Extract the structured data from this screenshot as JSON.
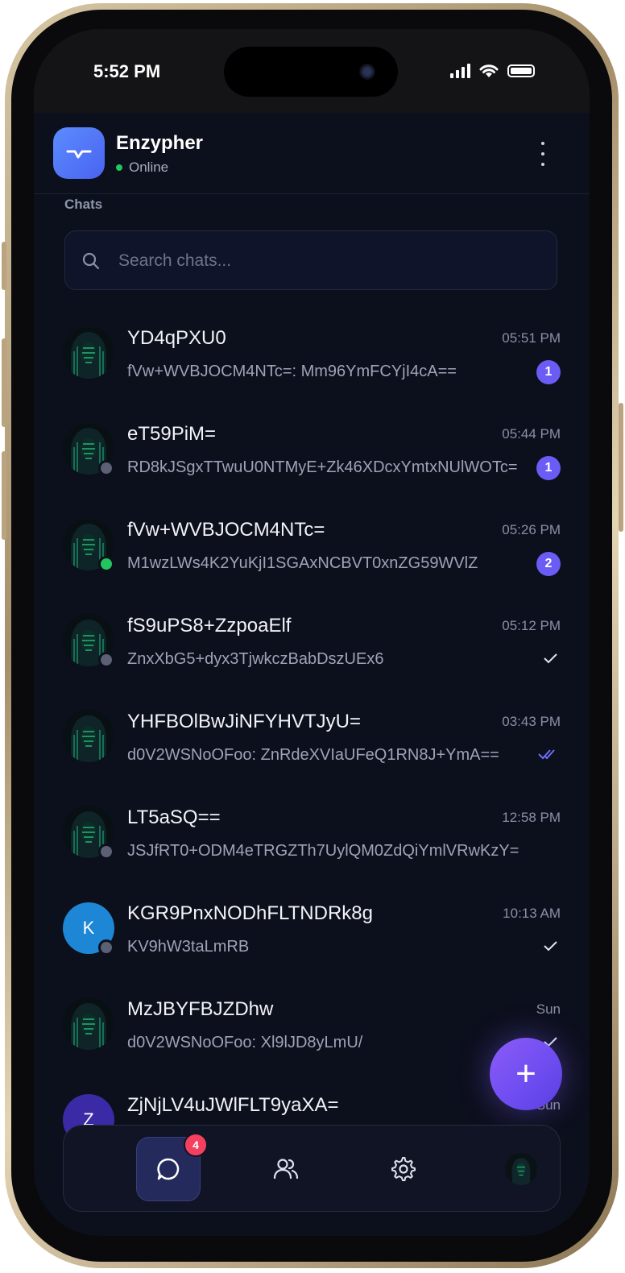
{
  "status_bar": {
    "time": "5:52 PM"
  },
  "header": {
    "app_name": "Enzypher",
    "status": "Online"
  },
  "section_title": "Chats",
  "search": {
    "placeholder": "Search chats..."
  },
  "chats": [
    {
      "name": "YD4qPXU0",
      "time": "05:51 PM",
      "preview": "fVw+WVBJOCM4NTc=: Mm96YmFCYjI4cA==",
      "unread": "1",
      "avatar": "hooded-figure",
      "presence": "none",
      "receipt": "none"
    },
    {
      "name": "eT59PiM=",
      "time": "05:44 PM",
      "preview": "RD8kJSgxTTwuU0NTMyE+Zk46XDcxYmtxNUlWOTc=",
      "unread": "1",
      "avatar": "hooded-figure",
      "presence": "offline",
      "receipt": "none"
    },
    {
      "name": "fVw+WVBJOCM4NTc=",
      "time": "05:26 PM",
      "preview": "M1wzLWs4K2YuKjI1SGAxNCBVT0xnZG59WVlZ",
      "unread": "2",
      "avatar": "hooded-figure",
      "presence": "online",
      "receipt": "none"
    },
    {
      "name": "fS9uPS8+ZzpoaElf",
      "time": "05:12 PM",
      "preview": "ZnxXbG5+dyx3TjwkczBabDszUEx6",
      "unread": "",
      "avatar": "hooded-figure",
      "presence": "offline",
      "receipt": "sent"
    },
    {
      "name": "YHFBOlBwJiNFYHVTJyU=",
      "time": "03:43 PM",
      "preview": "d0V2WSNoOFoo: ZnRdeXVIaUFeQ1RN8J+YmA==",
      "unread": "",
      "avatar": "hooded-figure",
      "presence": "none",
      "receipt": "read"
    },
    {
      "name": "LT5aSQ==",
      "time": "12:58 PM",
      "preview": "JSJfRT0+ODM4eTRGZTh7UylQM0ZdQiYmlVRwKzY=",
      "unread": "",
      "avatar": "hooded-figure",
      "presence": "offline",
      "receipt": "none"
    },
    {
      "name": "KGR9PnxNODhFLTNDRk8g",
      "time": "10:13 AM",
      "preview": "KV9hW3taLmRB",
      "unread": "",
      "avatar": "K",
      "presence": "offline",
      "receipt": "sent"
    },
    {
      "name": "MzJBYFBJZDhw",
      "time": "Sun",
      "preview": "d0V2WSNoOFoo: Xl9lJD8yLmU/",
      "unread": "",
      "avatar": "hooded-figure",
      "presence": "none",
      "receipt": "sent"
    },
    {
      "name": "ZjNjLV4uJWlFLT9yaXA=",
      "time": "Sun",
      "preview": "",
      "unread": "",
      "avatar": "Z",
      "presence": "none",
      "receipt": "none"
    }
  ],
  "fab": {
    "icon": "plus-icon",
    "label": "+"
  },
  "bottom_nav": [
    {
      "name": "chats",
      "icon": "chat-bubble-icon",
      "badge": "4",
      "active": true
    },
    {
      "name": "contacts",
      "icon": "users-icon",
      "badge": "",
      "active": false
    },
    {
      "name": "settings",
      "icon": "gear-icon",
      "badge": "",
      "active": false
    },
    {
      "name": "profile",
      "icon": "avatar",
      "badge": "",
      "active": false
    }
  ],
  "colors": {
    "accent": "#6a5cf5",
    "background": "#0c0f1c",
    "online": "#22c55e",
    "notification": "#f43f5e"
  }
}
